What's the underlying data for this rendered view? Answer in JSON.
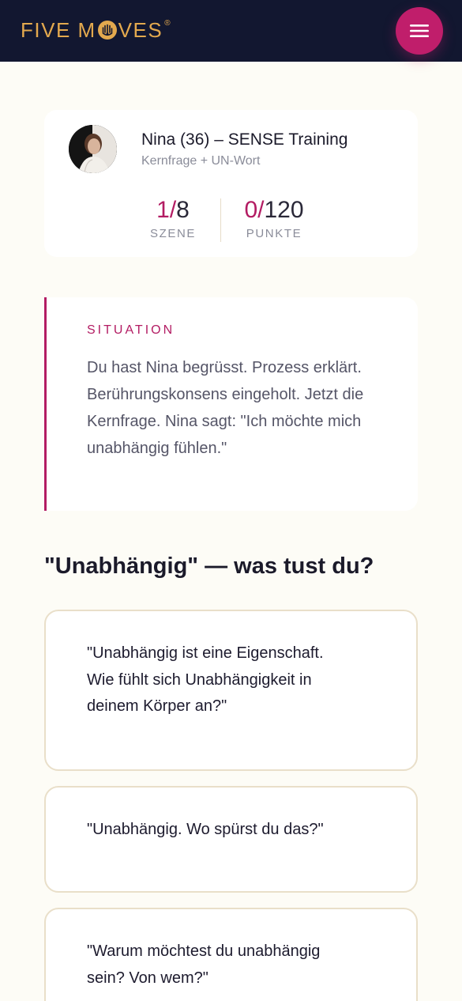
{
  "header": {
    "logo_part1": "FIVE M",
    "logo_part2": "VES",
    "logo_reg": "®",
    "logo_icon": "hand-eye-icon",
    "menu_icon": "hamburger-menu-icon",
    "colors": {
      "bar": "#121730",
      "logo": "#e3a94e",
      "menu_button": "#c01e6b"
    }
  },
  "profile": {
    "name": "Nina (36) – SENSE Training",
    "subtitle": "Kernfrage + UN-Wort",
    "avatar_icon": "avatar-photo",
    "scene": {
      "current": "1",
      "separator": "/",
      "total": "8",
      "label": "SZENE"
    },
    "points": {
      "current": "0",
      "separator": "/",
      "total": "120",
      "label": "PUNKTE"
    }
  },
  "situation": {
    "label": "SITUATION",
    "text": "Du hast Nina begrüsst. Prozess erklärt. Berührungskonsens eingeholt. Jetzt die Kernfrage. Nina sagt: \"Ich möchte mich unabhängig fühlen.\""
  },
  "question": "\"Unabhängig\" — was tust du?",
  "options": [
    {
      "text": "\"Unabhängig ist eine Eigenschaft. Wie fühlt sich Unabhängigkeit in deinem Körper an?\""
    },
    {
      "text": "\"Unabhängig. Wo spürst du das?\""
    },
    {
      "text": "\"Warum möchtest du unabhängig sein? Von wem?\""
    }
  ],
  "colors": {
    "accent": "#b31c63",
    "background": "#fdfcf6",
    "option_border": "#e9dfc9"
  }
}
